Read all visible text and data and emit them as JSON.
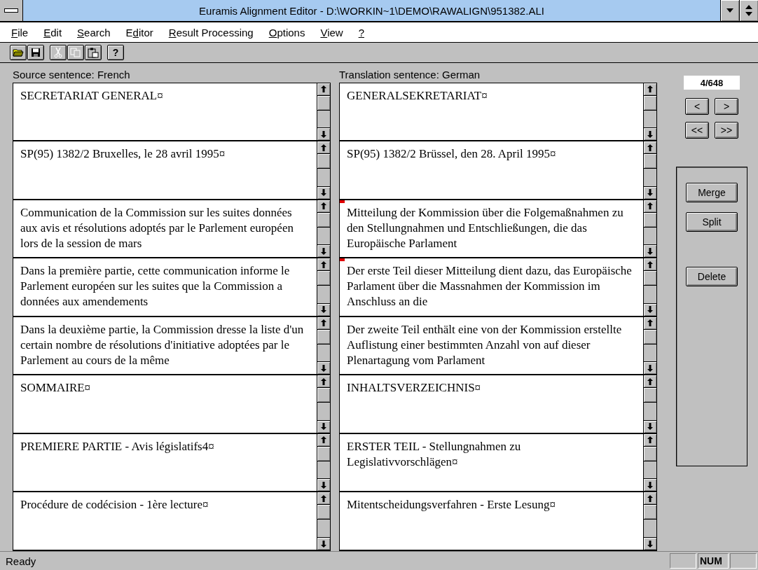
{
  "window": {
    "title": "Euramis Alignment Editor - D:\\WORKIN~1\\DEMO\\RAWALIGN\\951382.ALI"
  },
  "menu": [
    {
      "hotkey": "F",
      "rest": "ile"
    },
    {
      "hotkey": "E",
      "rest": "dit"
    },
    {
      "hotkey": "S",
      "rest": "earch"
    },
    {
      "lead": "E",
      "hotkey": "d",
      "rest": "itor"
    },
    {
      "hotkey": "R",
      "rest": "esult Processing"
    },
    {
      "hotkey": "O",
      "rest": "ptions"
    },
    {
      "hotkey": "V",
      "rest": "iew"
    },
    {
      "hotkey": "?"
    }
  ],
  "toolbar": [
    {
      "kind": "open",
      "disabled": false
    },
    {
      "kind": "save",
      "disabled": false
    },
    {
      "kind": "cut",
      "disabled": true
    },
    {
      "kind": "copy",
      "disabled": true
    },
    {
      "kind": "paste",
      "disabled": false
    },
    {
      "kind": "help",
      "disabled": false,
      "label": "?"
    }
  ],
  "source_label": "Source sentence: French",
  "target_label": "Translation sentence: German",
  "rows": [
    {
      "source": "SECRETARIAT GENERAL¤",
      "target": "GENERALSEKRETARIAT¤",
      "flagged": false
    },
    {
      "source": "SP(95) 1382/2 Bruxelles, le 28 avril 1995¤",
      "target": "SP(95) 1382/2 Brüssel, den 28. April 1995¤",
      "flagged": false
    },
    {
      "source": "Communication de la Commission sur les suites données aux avis et résolutions adoptés par le Parlement européen lors de la session de mars",
      "target": "Mitteilung der Kommission über die Folgemaßnahmen zu den Stellungnahmen und Entschließungen, die das Europäische Parlament",
      "flagged": true
    },
    {
      "source": "Dans la première partie, cette communication informe le Parlement européen sur les suites que la Commission a données aux amendements",
      "target": "Der erste Teil dieser Mitteilung dient dazu, das Europäische Parlament über die Massnahmen der Kommission im Anschluss an die",
      "flagged": true
    },
    {
      "source": "Dans la deuxième partie, la Commission dresse la liste d'un certain nombre de résolutions d'initiative adoptées par le Parlement au cours de la même",
      "target": "Der zweite Teil enthält eine von der Kommission erstellte Auflistung einer bestimmten Anzahl von auf dieser Plenartagung vom Parlament",
      "flagged": false
    },
    {
      "source": "SOMMAIRE¤",
      "target": "INHALTSVERZEICHNIS¤",
      "flagged": false
    },
    {
      "source": "PREMIERE PARTIE - Avis législatifs4¤",
      "target": "ERSTER TEIL - Stellungnahmen zu Legislativvorschlägen¤",
      "flagged": false
    },
    {
      "source": "Procédure de codécision - 1ère lecture¤",
      "target": "Mitentscheidungsverfahren - Erste Lesung¤",
      "flagged": false
    }
  ],
  "counter": "4/648",
  "nav_buttons": [
    "<",
    ">",
    "<<",
    ">>"
  ],
  "actions": [
    "Merge",
    "Split",
    "Delete"
  ],
  "status_bar": {
    "text": "Ready",
    "indicators": [
      "NUM"
    ]
  }
}
